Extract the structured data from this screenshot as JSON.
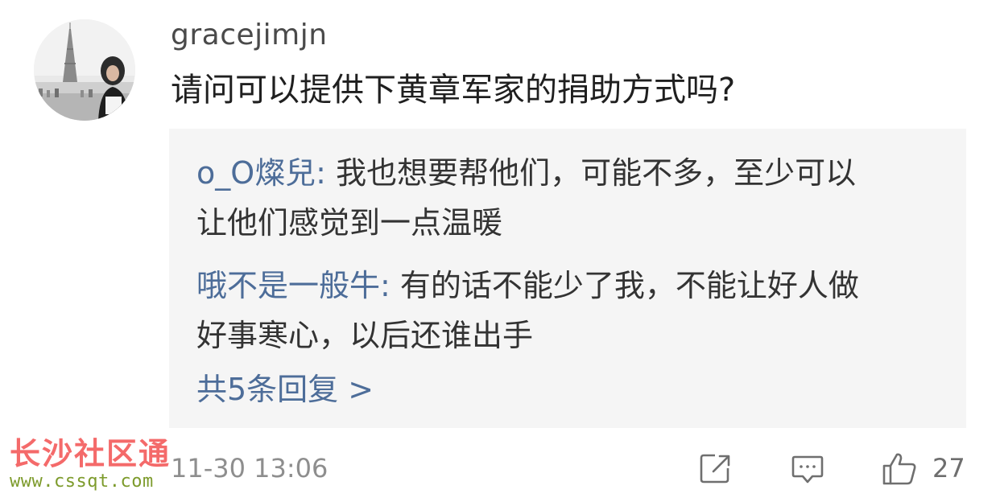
{
  "comment": {
    "username": "gracejimjn",
    "text": "请问可以提供下黄章军家的捐助方式吗?",
    "timestamp": "11-30 13:06",
    "like_count": "27",
    "avatar_icon": "eiffel-tower-avatar"
  },
  "replies": [
    {
      "author": "o_O燦兒",
      "separator": ": ",
      "text_line1": "我也想要帮他们，可能不多，至少可以",
      "text_line2": "让他们感觉到一点温暖"
    },
    {
      "author": "哦不是一般牛",
      "separator": ": ",
      "text_line1": "有的话不能少了我，不能让好人做",
      "text_line2": "好事寒心，以后还谁出手"
    }
  ],
  "more_replies": {
    "label": "共5条回复 >"
  },
  "watermark": {
    "title": "长沙社区通",
    "url": "www.cssqt.com"
  },
  "actions": {
    "forward_icon": "forward-icon",
    "reply_icon": "comment-icon",
    "like_icon": "thumbs-up-icon"
  },
  "colors": {
    "link": "#4d6d99",
    "reply_bg": "#f5f5f5",
    "muted": "#8e8e8e",
    "watermark_red": "#f46a6a",
    "watermark_green": "#7d9b2c"
  }
}
